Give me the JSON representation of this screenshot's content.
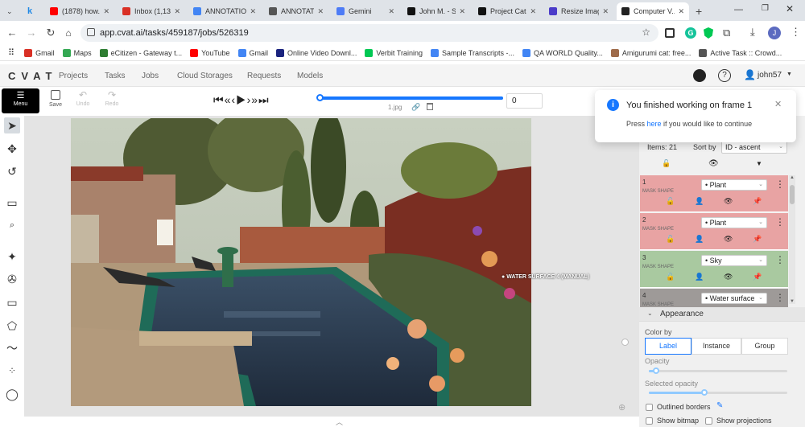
{
  "browser": {
    "tabs": [
      {
        "label": "(1878) how...",
        "color": "#ff0000"
      },
      {
        "label": "Inbox (1,13...",
        "color": "#d93025"
      },
      {
        "label": "ANNOTATIO...",
        "color": "#4285f4"
      },
      {
        "label": "ANNOTATIO...",
        "color": "#555555"
      },
      {
        "label": "Gemini",
        "color": "#4e7cf6"
      },
      {
        "label": "John M. - Sk...",
        "color": "#111111"
      },
      {
        "label": "Project Catal...",
        "color": "#111111"
      },
      {
        "label": "Resize Imag...",
        "color": "#4b3cc9"
      },
      {
        "label": "Computer V...",
        "color": "#222222"
      }
    ],
    "url": "app.cvat.ai/tasks/459187/jobs/526319",
    "profile_initial": "J",
    "bookmarks": [
      {
        "label": "Gmail",
        "color": "#d93025"
      },
      {
        "label": "Maps",
        "color": "#34a853"
      },
      {
        "label": "eCitizen - Gateway t...",
        "color": "#2e7d32"
      },
      {
        "label": "YouTube",
        "color": "#ff0000"
      },
      {
        "label": "Gmail",
        "color": "#4285f4"
      },
      {
        "label": "Online Video Downl...",
        "color": "#1a237e"
      },
      {
        "label": "Verbit Training",
        "color": "#00c853"
      },
      {
        "label": "Sample Transcripts -...",
        "color": "#4285f4"
      },
      {
        "label": "QA WORLD Quality...",
        "color": "#4285f4"
      },
      {
        "label": "Amigurumi cat: free...",
        "color": "#9e6b4a"
      },
      {
        "label": "Active Task :: Crowd...",
        "color": "#555555"
      }
    ]
  },
  "cvat": {
    "logo": "CVAT",
    "nav": [
      "Projects",
      "Tasks",
      "Jobs",
      "Cloud Storages",
      "Requests",
      "Models"
    ],
    "user": "john57"
  },
  "toolbar": {
    "menu": "Menu",
    "save": "Save",
    "undo": "Undo",
    "redo": "Redo",
    "filename": "1.jpg",
    "frame": "0",
    "frame_progress": 1.0
  },
  "notification": {
    "title": "You finished working on frame 1",
    "body_pre": "Press ",
    "link": "here",
    "body_post": " if you would like to continue"
  },
  "canvas": {
    "shape_label": "WATER SURFACE 4 (MANUAL)"
  },
  "objects_panel": {
    "items_label": "Items: 21",
    "sort_label": "Sort by",
    "sort_value": "ID - ascent",
    "items": [
      {
        "id": "1",
        "type": "MASK SHAPE",
        "label": "Plant",
        "color": "#e8a3a3"
      },
      {
        "id": "2",
        "type": "MASK SHAPE",
        "label": "Plant",
        "color": "#e8a3a3"
      },
      {
        "id": "3",
        "type": "MASK SHAPE",
        "label": "Sky",
        "color": "#a9c9a0"
      },
      {
        "id": "4",
        "type": "MASK SHAPE",
        "label": "Water surface",
        "color": "#9e9a98"
      }
    ]
  },
  "appearance": {
    "title": "Appearance",
    "color_by": "Color by",
    "options": [
      "Label",
      "Instance",
      "Group"
    ],
    "selected": "Label",
    "opacity": "Opacity",
    "opacity_value": 0.05,
    "selected_opacity": "Selected opacity",
    "selected_opacity_value": 0.4,
    "outlined": "Outlined borders",
    "show_bitmap": "Show bitmap",
    "show_projections": "Show projections"
  }
}
